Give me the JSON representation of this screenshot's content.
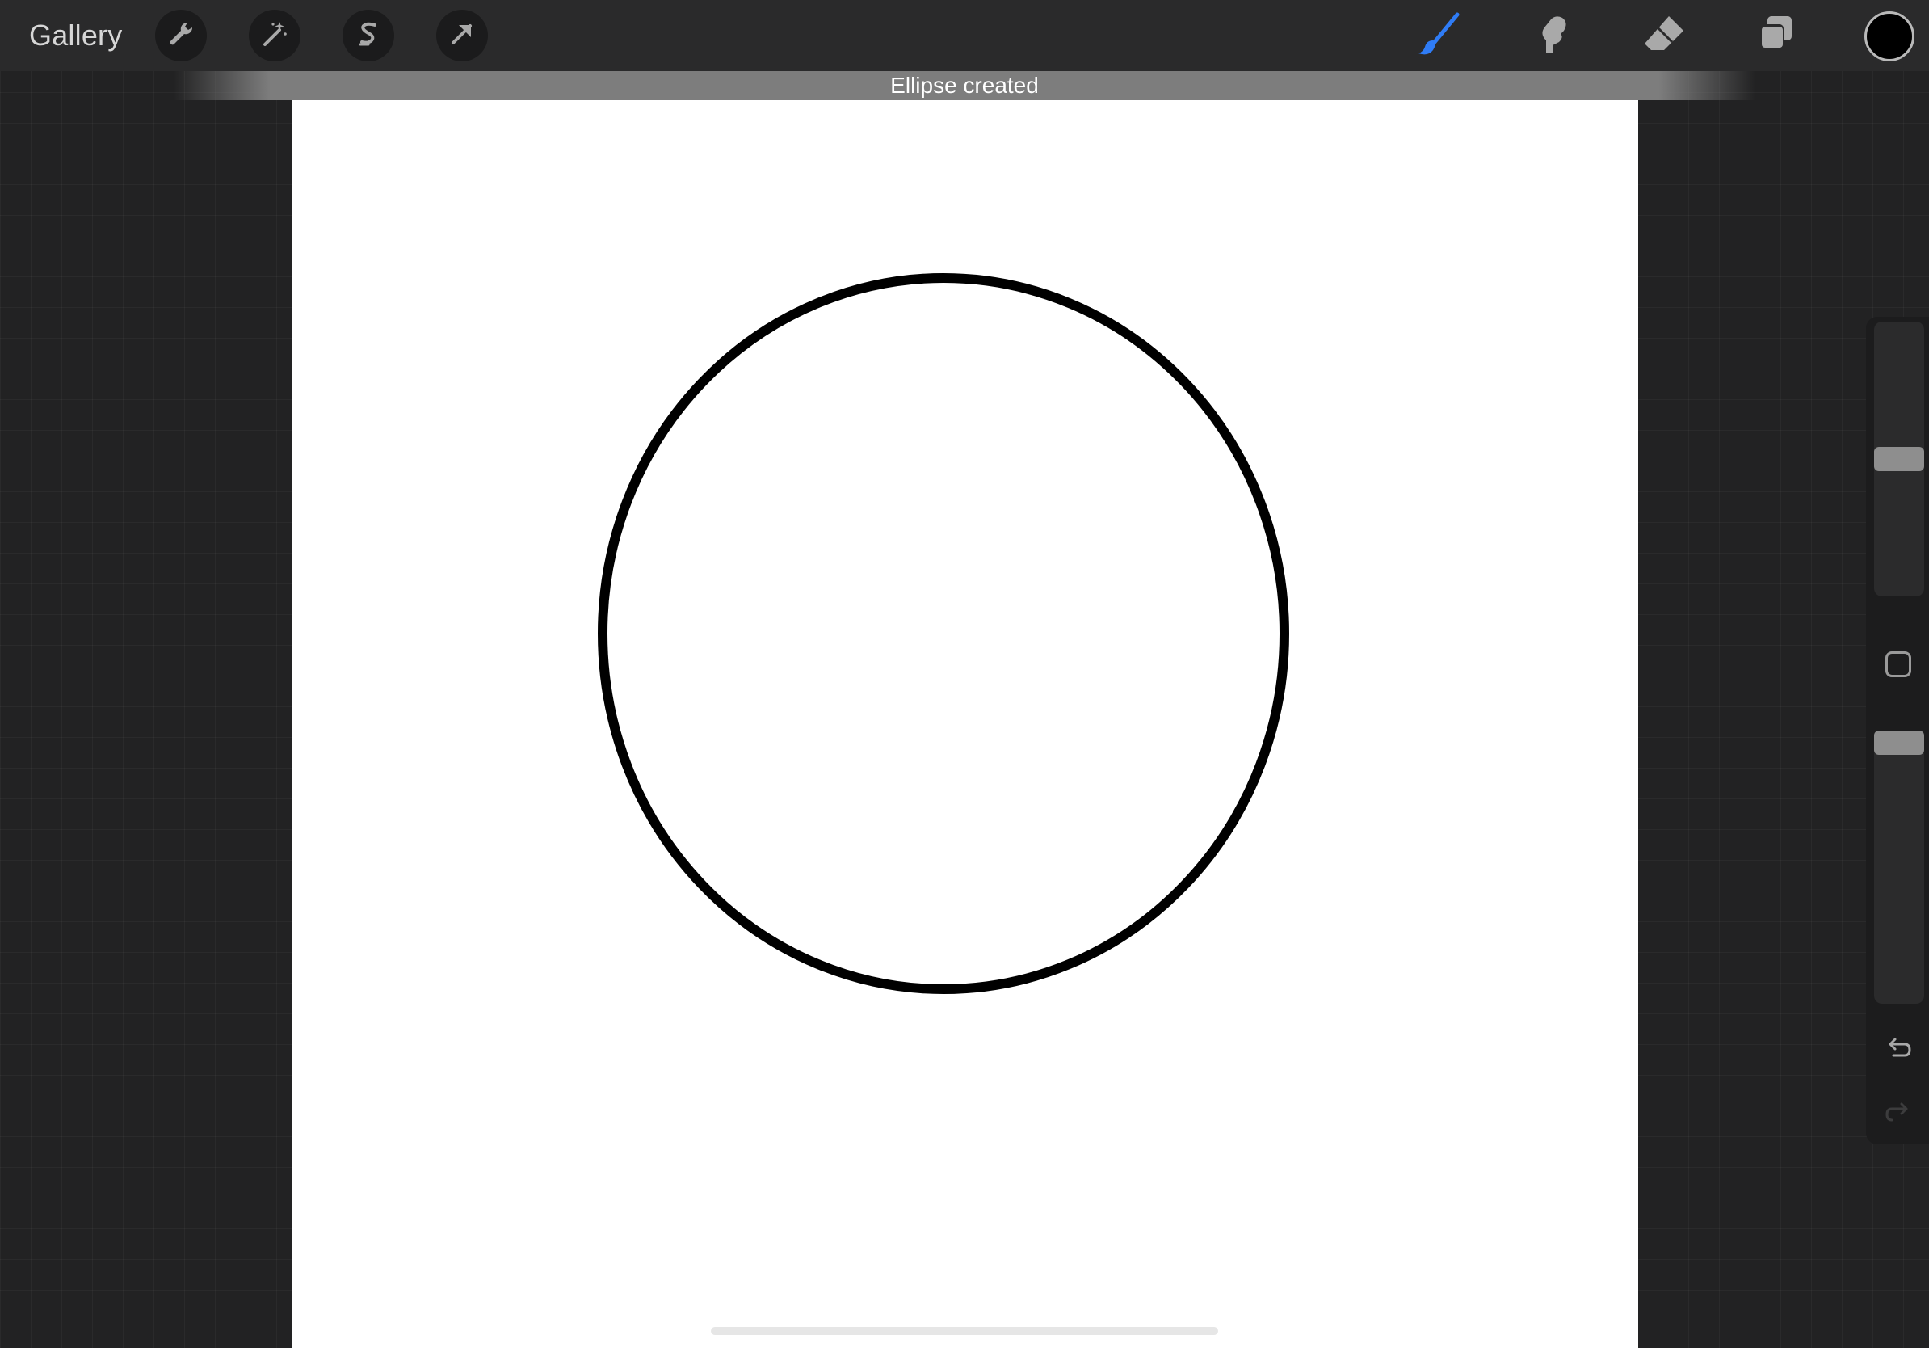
{
  "topbar": {
    "gallery_label": "Gallery",
    "left_tools": [
      {
        "name": "actions",
        "icon": "wrench-icon"
      },
      {
        "name": "adjustments",
        "icon": "magic-wand-icon"
      },
      {
        "name": "selection",
        "icon": "selection-s-icon"
      },
      {
        "name": "transform",
        "icon": "arrow-cursor-icon"
      }
    ],
    "right_tools": [
      {
        "name": "brush",
        "icon": "brush-icon",
        "active": true
      },
      {
        "name": "smudge",
        "icon": "smudge-finger-icon",
        "active": false
      },
      {
        "name": "eraser",
        "icon": "eraser-icon",
        "active": false
      },
      {
        "name": "layers",
        "icon": "layers-icon",
        "active": false
      }
    ],
    "current_color": "#000000"
  },
  "toast": {
    "message": "Ellipse created"
  },
  "canvas": {
    "background": "#ffffff",
    "stroke_color": "#000000"
  },
  "sidebar": {
    "brush_size_level": 0.5,
    "brush_opacity_level": 1.0,
    "undo_icon": "undo-arrow-icon",
    "redo_icon": "redo-arrow-icon"
  },
  "colors": {
    "accent": "#2f7cf6",
    "toolbar_bg": "#2a2a2b",
    "workspace_bg": "#222223"
  }
}
